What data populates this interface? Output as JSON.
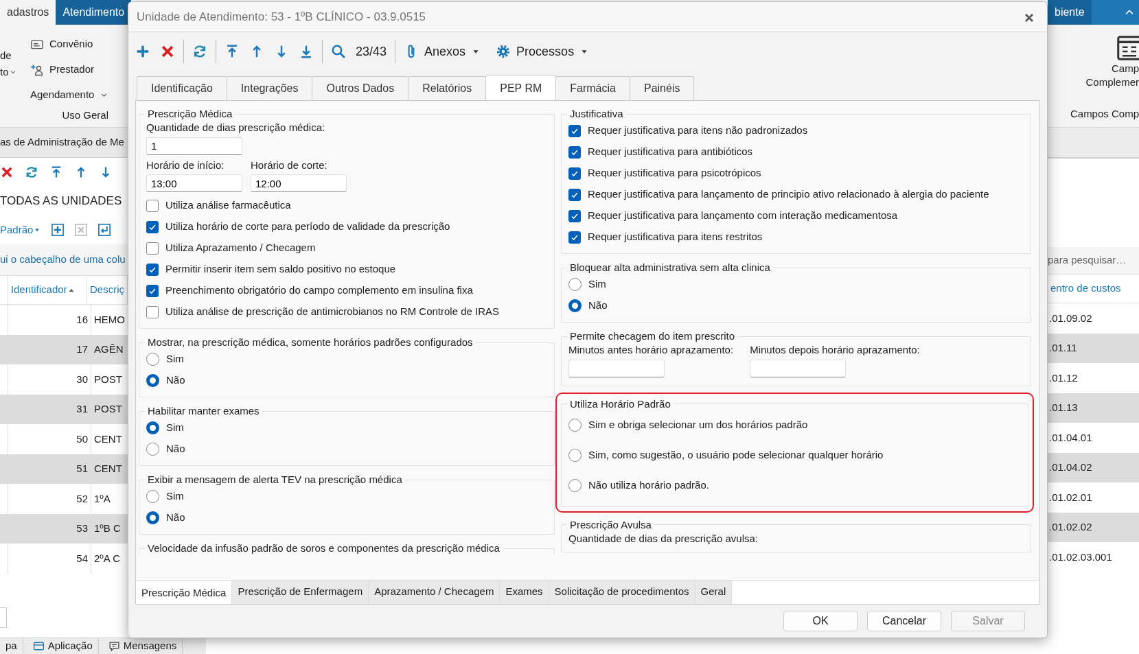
{
  "app": {
    "ribbon_tabs": [
      {
        "label": "adastros",
        "selected": true
      },
      {
        "label": "Atendimento",
        "selected": false
      }
    ],
    "right_tab": "biente",
    "ribbon_cut": [
      "de",
      "to"
    ],
    "ribbon_items": [
      {
        "kind": "icon",
        "label": "Convênio"
      },
      {
        "kind": "icon",
        "label": "Prestador"
      },
      {
        "kind": "dropdown",
        "label": "Agendamento"
      }
    ],
    "ribbon_group": "Uso Geral",
    "ribbon_right_button": [
      "Camp",
      "Complemer"
    ],
    "ribbon_right_group": "Campos Comp",
    "view_title": "as de Administração de Me",
    "filter_title": "TODAS AS UNIDADES",
    "layout_menu": "Padrão",
    "group_hint": "ui o cabeçalho de uma colu",
    "search_placeholder": "para pesquisar…",
    "grid": {
      "columns": [
        {
          "label": "Identificador",
          "sorted": true
        },
        {
          "label": "Descriç",
          "sorted": false
        },
        {
          "label": "entro de custos",
          "sorted": false
        }
      ],
      "rows": [
        [
          "16",
          "HEMO",
          ".01.09.02"
        ],
        [
          "17",
          "AGÊN",
          ".01.11"
        ],
        [
          "30",
          "POST",
          ".01.12"
        ],
        [
          "31",
          "POST",
          ".01.13"
        ],
        [
          "50",
          "CENT",
          ".01.04.01"
        ],
        [
          "51",
          "CENT",
          ".01.04.02"
        ],
        [
          "52",
          "1ºA",
          ".01.02.01"
        ],
        [
          "53",
          "1ºB C",
          ".01.02.02"
        ],
        [
          "54",
          "2ºA C",
          ".01.02.03.001"
        ]
      ]
    },
    "status_bar": [
      {
        "kind": "text",
        "label": "pa"
      },
      {
        "kind": "app",
        "label": "Aplicação"
      },
      {
        "kind": "msg",
        "label": "Mensagens"
      }
    ]
  },
  "dialog": {
    "title": "Unidade de Atendimento: 53 - 1ºB CLÍNICO - 03.9.0515",
    "counter": "23/43",
    "menus": [
      {
        "label": "Anexos"
      },
      {
        "label": "Processos"
      }
    ],
    "tabs": [
      {
        "label": "Identificação",
        "selected": false
      },
      {
        "label": "Integrações",
        "selected": false
      },
      {
        "label": "Outros Dados",
        "selected": false
      },
      {
        "label": "Relatórios",
        "selected": false
      },
      {
        "label": "PEP RM",
        "selected": true
      },
      {
        "label": "Farmácia",
        "selected": false
      },
      {
        "label": "Painéis",
        "selected": false
      }
    ],
    "left_groups": [
      {
        "title": "Prescrição Médica",
        "items": [
          {
            "kind": "fields",
            "fields": [
              {
                "label": "Quantidade de dias prescrição médica:",
                "value": "1"
              }
            ]
          },
          {
            "kind": "fields",
            "fields": [
              {
                "label": "Horário de início:",
                "value": "13:00"
              },
              {
                "label": "Horário de corte:",
                "value": "12:00"
              }
            ]
          },
          {
            "kind": "checkbox",
            "label": "Utiliza análise farmacêutica",
            "checked": false
          },
          {
            "kind": "checkbox",
            "label": "Utiliza horário de corte para período de validade da prescrição",
            "checked": true
          },
          {
            "kind": "checkbox",
            "label": "Utiliza Aprazamento / Checagem",
            "checked": false
          },
          {
            "kind": "checkbox",
            "label": "Permitir inserir item sem saldo positivo no estoque",
            "checked": true
          },
          {
            "kind": "checkbox",
            "label": "Preenchimento obrigatório do campo complemento em insulina fixa",
            "checked": true
          },
          {
            "kind": "checkbox",
            "label": "Utiliza análise de prescrição de antimicrobianos no RM Controle de IRAS",
            "checked": false
          }
        ]
      },
      {
        "title": "Mostrar, na prescrição médica, somente horários padrões configurados",
        "items": [
          {
            "kind": "radio",
            "label": "Sim",
            "selected": false
          },
          {
            "kind": "radio",
            "label": "Não",
            "selected": true
          }
        ]
      },
      {
        "title": "Habilitar manter exames",
        "items": [
          {
            "kind": "radio",
            "label": "Sim",
            "selected": true
          },
          {
            "kind": "radio",
            "label": "Não",
            "selected": false
          }
        ]
      },
      {
        "title": "Exibir a mensagem de alerta TEV na prescrição médica",
        "items": [
          {
            "kind": "radio",
            "label": "Sim",
            "selected": false
          },
          {
            "kind": "radio",
            "label": "Não",
            "selected": true
          }
        ]
      },
      {
        "title": "Velocidade da infusão padrão de soros e componentes da prescrição médica"
      }
    ],
    "right_groups": [
      {
        "title": "Justificativa",
        "highlighted": false,
        "items": [
          {
            "kind": "checkbox",
            "label": "Requer justificativa para itens não padronizados",
            "checked": true
          },
          {
            "kind": "checkbox",
            "label": "Requer justificativa para antibióticos",
            "checked": true
          },
          {
            "kind": "checkbox",
            "label": "Requer justificativa para psicotrópicos",
            "checked": true
          },
          {
            "kind": "checkbox",
            "label": "Requer justificativa para lançamento de principio ativo relacionado à alergia do paciente",
            "checked": true
          },
          {
            "kind": "checkbox",
            "label": "Requer justificativa para lançamento com interação medicamentosa",
            "checked": true
          },
          {
            "kind": "checkbox",
            "label": "Requer justificativa para itens restritos",
            "checked": true
          }
        ]
      },
      {
        "title": "Bloquear alta administrativa sem alta clinica",
        "highlighted": false,
        "items": [
          {
            "kind": "radio",
            "label": "Sim",
            "selected": false
          },
          {
            "kind": "radio",
            "label": "Não",
            "selected": true
          }
        ]
      },
      {
        "title": "Permite checagem do item prescrito",
        "highlighted": false,
        "items": [
          {
            "kind": "fields",
            "fields": [
              {
                "label": "Minutos antes horário aprazamento:"
              },
              {
                "label": "Minutos depois horário aprazamento:"
              }
            ]
          }
        ]
      },
      {
        "title": "Utiliza Horário Padrão",
        "highlighted": true,
        "items": [
          {
            "kind": "radio",
            "label": "Sim e obriga selecionar um dos horários padrão",
            "selected": false
          },
          {
            "kind": "radio",
            "label": "Sim, como sugestão, o usuário pode selecionar qualquer horário",
            "selected": false
          },
          {
            "kind": "radio",
            "label": "Não utiliza horário padrão.",
            "selected": false
          }
        ]
      },
      {
        "title": "Prescrição Avulsa",
        "highlighted": false,
        "items": [
          {
            "kind": "label",
            "label": "Quantidade de dias da prescrição avulsa:"
          }
        ]
      }
    ],
    "bottom_tabs": [
      {
        "label": "Prescrição Médica",
        "selected": true
      },
      {
        "label": "Prescrição de Enfermagem",
        "selected": false
      },
      {
        "label": "Aprazamento / Checagem",
        "selected": false
      },
      {
        "label": "Exames",
        "selected": false
      },
      {
        "label": "Solicitação de procedimentos",
        "selected": false
      },
      {
        "label": "Geral",
        "selected": false
      }
    ],
    "buttons": [
      {
        "label": "OK",
        "disabled": false
      },
      {
        "label": "Cancelar",
        "disabled": false
      },
      {
        "label": "Salvar",
        "disabled": true
      }
    ]
  }
}
